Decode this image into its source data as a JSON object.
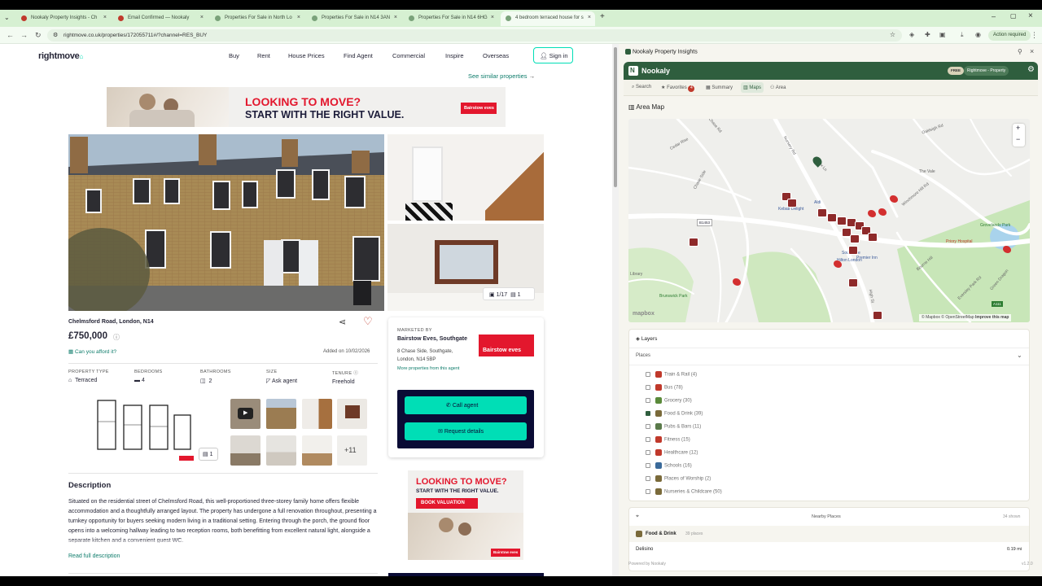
{
  "browser": {
    "tabs": [
      {
        "label": "Nookaly Property Insights - Ch",
        "active": false
      },
      {
        "label": "Email Confirmed — Nookaly",
        "active": false
      },
      {
        "label": "Properties For Sale in North Lo",
        "active": false
      },
      {
        "label": "Properties For Sale in N14 3AN",
        "active": false
      },
      {
        "label": "Properties For Sale in N14 6HG",
        "active": false
      },
      {
        "label": "4 bedroom terraced house for s",
        "active": true
      }
    ],
    "new_tab": "+",
    "url": "rightmove.co.uk/properties/172055711#/?channel=RES_BUY",
    "action_required": "Action required"
  },
  "site": {
    "logo": "rightmove",
    "nav": [
      "Buy",
      "Rent",
      "House Prices",
      "Find Agent",
      "Commercial",
      "Inspire",
      "Overseas"
    ],
    "sign_in": "Sign in",
    "see_similar": "See similar properties",
    "banner": {
      "line1": "LOOKING TO MOVE?",
      "line2": "START WITH THE RIGHT VALUE.",
      "brand": "Bairstow eves"
    },
    "photo_counter": "1/17",
    "floorplan_count": "1"
  },
  "property": {
    "address": "Chelmsford Road, London, N14",
    "price": "£750,000",
    "afford": "Can you afford it?",
    "added": "Added on 10/02/2026",
    "facts": [
      {
        "label": "PROPERTY TYPE",
        "value": "Terraced"
      },
      {
        "label": "BEDROOMS",
        "value": "4"
      },
      {
        "label": "BATHROOMS",
        "value": "2"
      },
      {
        "label": "SIZE",
        "value": "Ask agent"
      },
      {
        "label": "TENURE",
        "value": "Freehold"
      }
    ],
    "media_more": "+11",
    "floorplan_badge": "1",
    "description_title": "Description",
    "description": "Situated on the residential street of Chelmsford Road, this well-proportioned three-storey family home offers flexible accommodation and a thoughtfully arranged layout. The property has undergone a full renovation throughout, presenting a turnkey opportunity for buyers seeking modern living in a traditional setting. Entering through the porch, the ground floor opens into a welcoming hallway leading to two reception rooms, both benefitting from excellent natural light, alongside a separate kitchen and a convenient guest WC.",
    "read_more": "Read full description"
  },
  "agent": {
    "marketed_by": "MARKETED BY",
    "name": "Bairstow Eves, Southgate",
    "address": [
      "8 Chase Side, Southgate,",
      "London, N14 5BP"
    ],
    "more": "More properties from this agent",
    "logo": "Bairstow eves",
    "call": "Call agent",
    "request": "Request details"
  },
  "ad2": {
    "line1": "LOOKING TO MOVE?",
    "line2": "START WITH THE RIGHT VALUE.",
    "cta": "BOOK VALUATION",
    "brand": "Bairstow eves"
  },
  "panel": {
    "window_title": "Nookaly Property Insights",
    "brand": "Nookaly",
    "badge_free": "FREE",
    "badge_source": "Rightmove - Property",
    "tabs": [
      "Search",
      "Favorites",
      "Summary",
      "Maps",
      "Area"
    ],
    "favorites_count": "4",
    "section_title": "Area Map",
    "map": {
      "roads": [
        "Chase Rd",
        "Cedar Rise",
        "Chase Side",
        "Oakleigh Rd",
        "Nursery Rd",
        "Winchmore Hill Rd",
        "The Vale",
        "Fox Ln",
        "Grovelands Park",
        "Priory Hospital",
        "Southgate",
        "Kebab Delight",
        "Aldi",
        "Premier Inn",
        "Hilton London",
        "B1453",
        "Brunswick Park",
        "Library",
        "High St",
        "Bourne Hill",
        "Green Dragon",
        "A111",
        "Eversley Park Rd"
      ],
      "zoom_in": "+",
      "zoom_out": "−",
      "credit": "© Mapbox © OpenStreetMap",
      "improve": "Improve this map",
      "logo": "mapbox"
    },
    "layers_title": "Layers",
    "places_label": "Places",
    "places": [
      {
        "label": "Train & Rail",
        "count": "(4)",
        "checked": false,
        "color": "#c0392b"
      },
      {
        "label": "Bus",
        "count": "(78)",
        "checked": false,
        "color": "#c0392b"
      },
      {
        "label": "Grocery",
        "count": "(30)",
        "checked": false,
        "color": "#5a8a3a"
      },
      {
        "label": "Food & Drink",
        "count": "(39)",
        "checked": true,
        "color": "#7a6a3a"
      },
      {
        "label": "Pubs & Bars",
        "count": "(11)",
        "checked": false,
        "color": "#5a7a4a"
      },
      {
        "label": "Fitness",
        "count": "(15)",
        "checked": false,
        "color": "#c0392b"
      },
      {
        "label": "Healthcare",
        "count": "(12)",
        "checked": false,
        "color": "#c0392b"
      },
      {
        "label": "Schools",
        "count": "(16)",
        "checked": false,
        "color": "#3a6a9a"
      },
      {
        "label": "Places of Worship",
        "count": "(2)",
        "checked": false,
        "color": "#7a6a3a"
      },
      {
        "label": "Nurseries & Childcare",
        "count": "(50)",
        "checked": false,
        "color": "#7a6a3a"
      }
    ],
    "nearby_title": "Nearby Places",
    "nearby_shown": "34 shown",
    "nearby_category": "Food & Drink",
    "nearby_category_count": "39 places",
    "nearby_first": {
      "name": "Delisino",
      "dist": "0.19 mi"
    },
    "footer": "Powered by Nookaly",
    "version": "v1.2.0"
  },
  "colors": {
    "accent_green": "#2f5e3e",
    "cta_green": "#00deb6",
    "agent_navy": "#0a0b35",
    "link": "#0e7c6b"
  }
}
